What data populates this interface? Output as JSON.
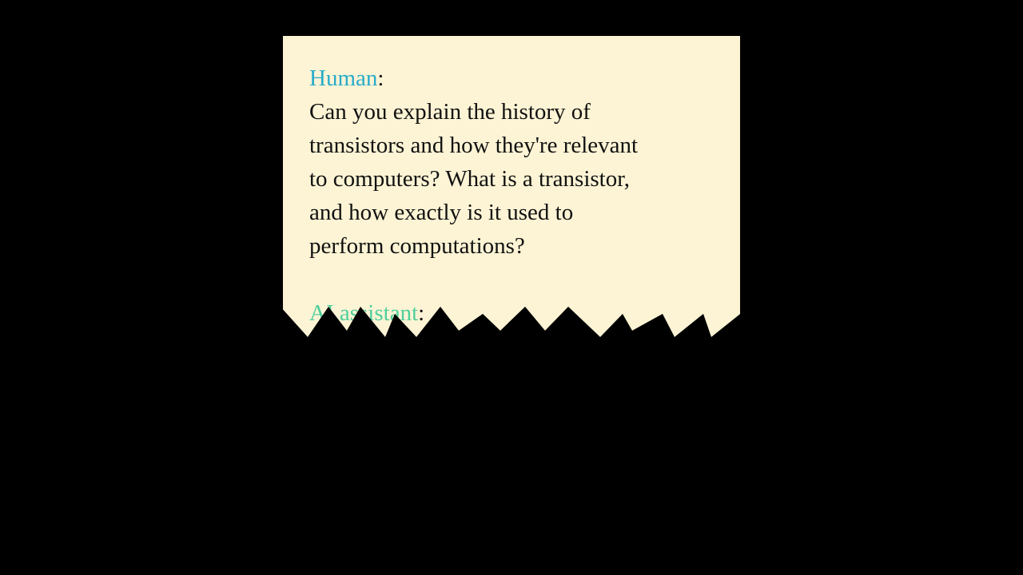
{
  "dialog": {
    "human_label": "Human",
    "colon": ":",
    "human_lines": [
      "Can you explain the history of",
      "transistors and how they're relevant",
      "to computers? What is a transistor,",
      "and how exactly is it used to",
      "perform computations?"
    ],
    "ai_label": "AI assistant",
    "colors": {
      "human": "#29abca",
      "ai": "#4fcf9c",
      "paper": "#fdf4d5"
    }
  }
}
